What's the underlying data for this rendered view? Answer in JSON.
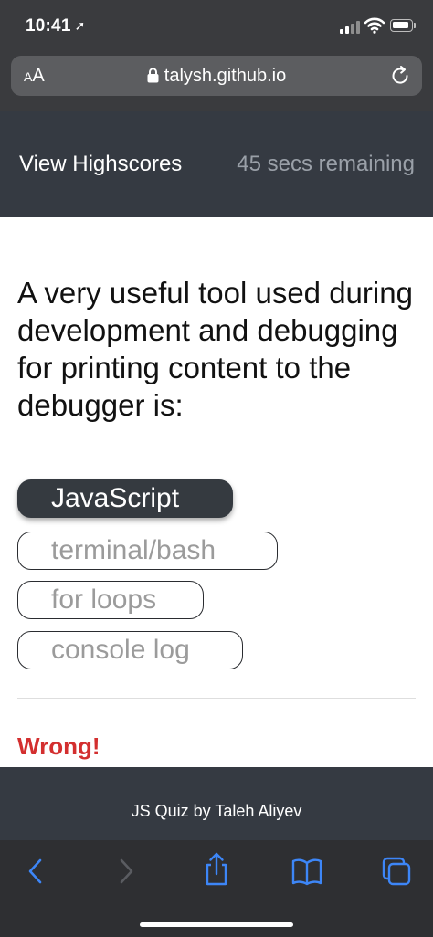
{
  "status_bar": {
    "time": "10:41",
    "location_arrow": "➚"
  },
  "browser": {
    "text_size_small": "A",
    "text_size_large": "A",
    "url": "talysh.github.io"
  },
  "header": {
    "highscores_link": "View Highscores",
    "timer": "45 secs remaining"
  },
  "quiz": {
    "question": "A very useful tool used during development and debugging for printing content to the debugger is:",
    "choices": [
      {
        "label": "JavaScript",
        "selected": true
      },
      {
        "label": "terminal/bash",
        "selected": false
      },
      {
        "label": "for loops",
        "selected": false
      },
      {
        "label": "console log",
        "selected": false
      }
    ],
    "result": "Wrong!"
  },
  "footer": {
    "credit": "JS Quiz by Taleh Aliyev"
  },
  "colors": {
    "header_bg": "#353a42",
    "selected_choice_bg": "#353a40",
    "wrong_text": "#d32f2f",
    "toolbar_icon": "#3d86f7"
  },
  "icons": [
    "location-arrow-icon",
    "signal-icon",
    "wifi-icon",
    "battery-icon",
    "lock-icon",
    "reload-icon",
    "back-icon",
    "forward-icon",
    "share-icon",
    "bookmarks-icon",
    "tabs-icon"
  ]
}
